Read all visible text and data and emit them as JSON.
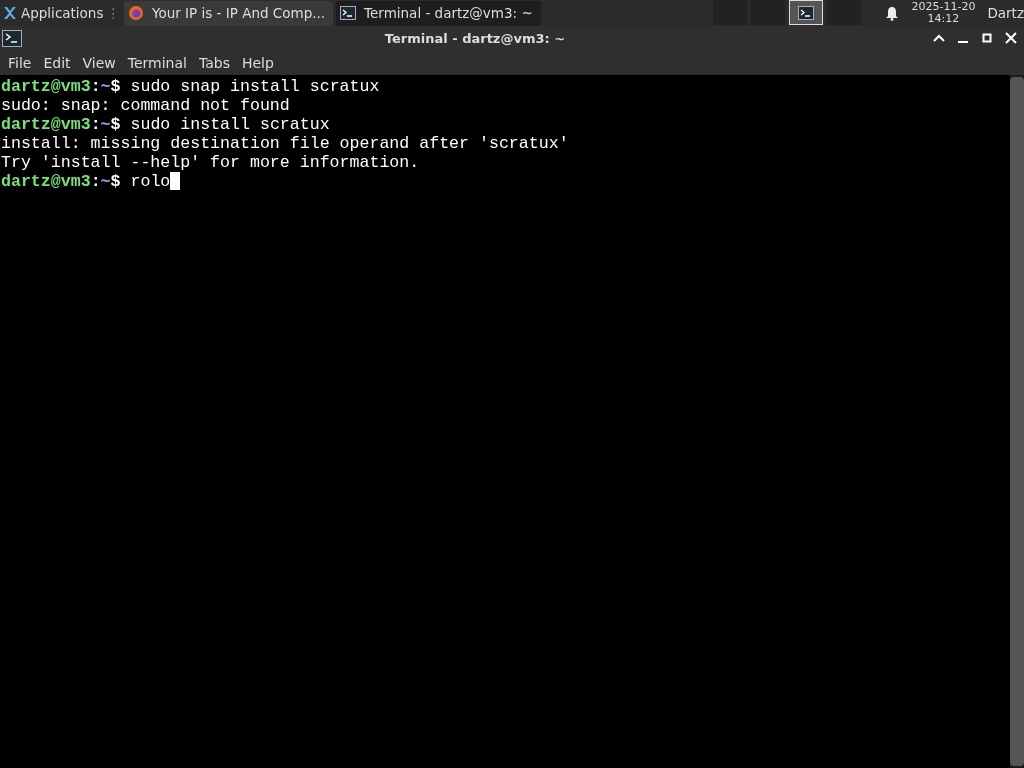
{
  "panel": {
    "app_menu": "Applications",
    "app_menu_glyph": "⋮",
    "tasks": [
      {
        "title": "Your IP is - IP And Comp...",
        "kind": "browser",
        "selected": false
      },
      {
        "title": "Terminal - dartz@vm3: ~",
        "kind": "terminal",
        "selected": true
      }
    ],
    "workspaces": [
      {
        "selected": false
      },
      {
        "selected": false
      },
      {
        "selected": true
      },
      {
        "selected": false
      }
    ],
    "clock": {
      "date": "2025-11-20",
      "time": "14:12"
    },
    "user": "Dartz"
  },
  "window": {
    "title": "Terminal - dartz@vm3: ~"
  },
  "menu": [
    "File",
    "Edit",
    "View",
    "Terminal",
    "Tabs",
    "Help"
  ],
  "terminal": {
    "lines": [
      {
        "kind": "prompt",
        "user": "dartz@vm3",
        "separator": ":",
        "path": "~",
        "symbol": "$",
        "command": "sudo snap install scratux",
        "cursor": false
      },
      {
        "kind": "output",
        "text": "sudo: snap: command not found"
      },
      {
        "kind": "prompt",
        "user": "dartz@vm3",
        "separator": ":",
        "path": "~",
        "symbol": "$",
        "command": "sudo install scratux",
        "cursor": false
      },
      {
        "kind": "output",
        "text": "install: missing destination file operand after 'scratux'"
      },
      {
        "kind": "output",
        "text": "Try 'install --help' for more information."
      },
      {
        "kind": "prompt",
        "user": "dartz@vm3",
        "separator": ":",
        "path": "~",
        "symbol": "$",
        "command": "rolo",
        "cursor": true
      }
    ]
  }
}
